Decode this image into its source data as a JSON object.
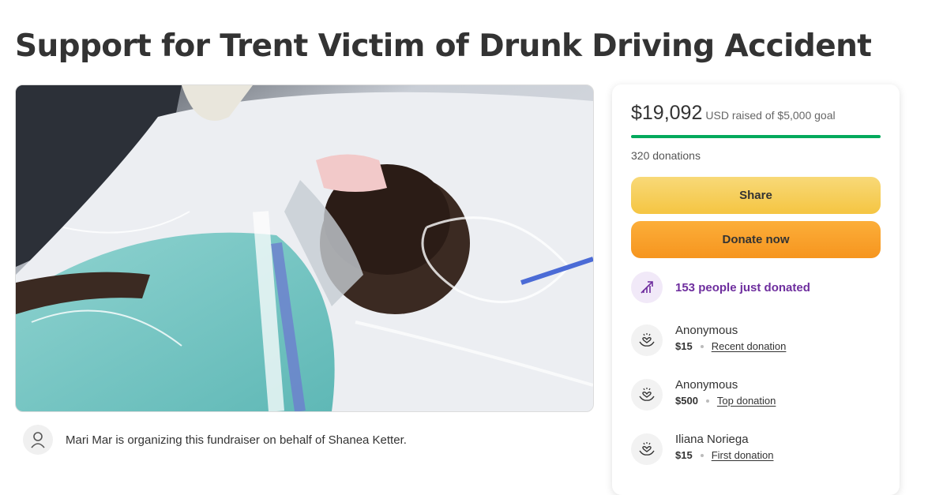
{
  "page": {
    "title": "Support for Trent Victim of Drunk Driving Accident"
  },
  "hero": {
    "image_icon": "hospital-photo"
  },
  "organizer": {
    "icon": "person-icon",
    "text": "Mari Mar is organizing this fundraiser on behalf of Shanea Ketter."
  },
  "donation_card": {
    "raised_amount": "$19,092",
    "raised_label": "USD raised of $5,000 goal",
    "progress_fraction": 1.0,
    "donations_count": "320 donations",
    "share_label": "Share",
    "donate_label": "Donate now",
    "trending_text": "153 people just donated",
    "colors": {
      "progress": "#02a95c",
      "trending": "#6e2e9e",
      "share_button": "#f5c542",
      "donate_button": "#f6951e"
    },
    "donors": [
      {
        "name": "Anonymous",
        "amount": "$15",
        "tag": "Recent donation",
        "icon": "heart-hands-icon"
      },
      {
        "name": "Anonymous",
        "amount": "$500",
        "tag": "Top donation",
        "icon": "heart-hands-icon"
      },
      {
        "name": "Iliana Noriega",
        "amount": "$15",
        "tag": "First donation",
        "icon": "heart-hands-icon"
      }
    ]
  }
}
